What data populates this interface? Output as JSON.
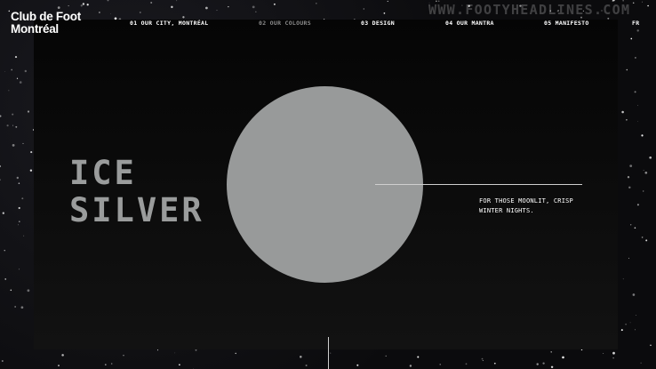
{
  "brand": {
    "logo_line1": "Club de Foot",
    "logo_line2": "Montréal"
  },
  "nav": {
    "items": [
      {
        "label": "01 OUR CITY, MONTRÉAL",
        "active": false
      },
      {
        "label": "02 OUR COLOURS",
        "active": true
      },
      {
        "label": "03 DESIGN",
        "active": false
      },
      {
        "label": "04 OUR MANTRA",
        "active": false
      },
      {
        "label": "05 MANIFESTO",
        "active": false
      },
      {
        "label": "FR",
        "active": false
      }
    ]
  },
  "watermark": "WWW.FOOTYHEADLINES.COM",
  "colour": {
    "name_line1": "ICE",
    "name_line2": "SILVER",
    "swatch_color": "#989a9a",
    "description": "FOR THOSE MOONLIT, CRISP WINTER NIGHTS."
  },
  "colors": {
    "background": "#0b0b0d",
    "panel": "#0a0a0a",
    "accent_silver": "#989a9a",
    "text_primary": "#ffffff",
    "nav_inactive": "#8a8a8a"
  }
}
